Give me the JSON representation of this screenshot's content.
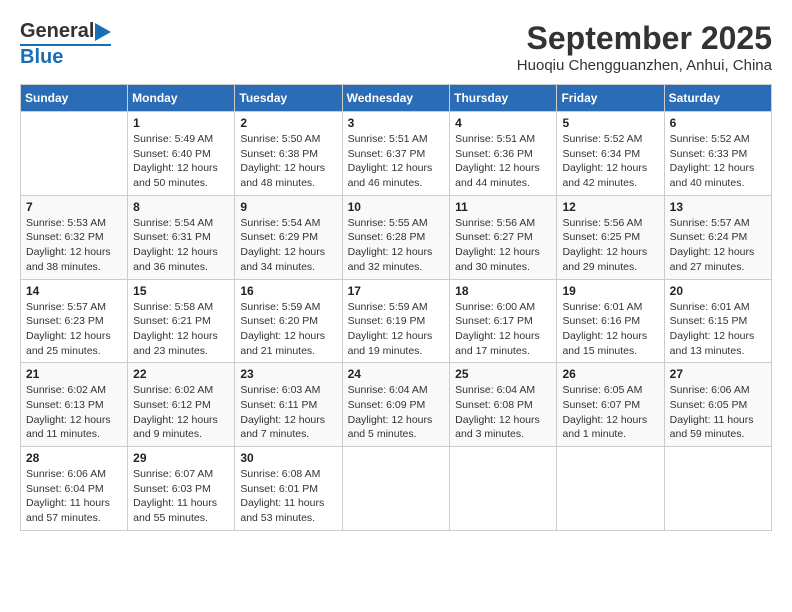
{
  "header": {
    "logo_general": "General",
    "logo_blue": "Blue",
    "title": "September 2025",
    "subtitle": "Huoqiu Chengguanzhen, Anhui, China"
  },
  "days_of_week": [
    "Sunday",
    "Monday",
    "Tuesday",
    "Wednesday",
    "Thursday",
    "Friday",
    "Saturday"
  ],
  "weeks": [
    [
      {
        "num": "",
        "info": ""
      },
      {
        "num": "1",
        "info": "Sunrise: 5:49 AM\nSunset: 6:40 PM\nDaylight: 12 hours\nand 50 minutes."
      },
      {
        "num": "2",
        "info": "Sunrise: 5:50 AM\nSunset: 6:38 PM\nDaylight: 12 hours\nand 48 minutes."
      },
      {
        "num": "3",
        "info": "Sunrise: 5:51 AM\nSunset: 6:37 PM\nDaylight: 12 hours\nand 46 minutes."
      },
      {
        "num": "4",
        "info": "Sunrise: 5:51 AM\nSunset: 6:36 PM\nDaylight: 12 hours\nand 44 minutes."
      },
      {
        "num": "5",
        "info": "Sunrise: 5:52 AM\nSunset: 6:34 PM\nDaylight: 12 hours\nand 42 minutes."
      },
      {
        "num": "6",
        "info": "Sunrise: 5:52 AM\nSunset: 6:33 PM\nDaylight: 12 hours\nand 40 minutes."
      }
    ],
    [
      {
        "num": "7",
        "info": "Sunrise: 5:53 AM\nSunset: 6:32 PM\nDaylight: 12 hours\nand 38 minutes."
      },
      {
        "num": "8",
        "info": "Sunrise: 5:54 AM\nSunset: 6:31 PM\nDaylight: 12 hours\nand 36 minutes."
      },
      {
        "num": "9",
        "info": "Sunrise: 5:54 AM\nSunset: 6:29 PM\nDaylight: 12 hours\nand 34 minutes."
      },
      {
        "num": "10",
        "info": "Sunrise: 5:55 AM\nSunset: 6:28 PM\nDaylight: 12 hours\nand 32 minutes."
      },
      {
        "num": "11",
        "info": "Sunrise: 5:56 AM\nSunset: 6:27 PM\nDaylight: 12 hours\nand 30 minutes."
      },
      {
        "num": "12",
        "info": "Sunrise: 5:56 AM\nSunset: 6:25 PM\nDaylight: 12 hours\nand 29 minutes."
      },
      {
        "num": "13",
        "info": "Sunrise: 5:57 AM\nSunset: 6:24 PM\nDaylight: 12 hours\nand 27 minutes."
      }
    ],
    [
      {
        "num": "14",
        "info": "Sunrise: 5:57 AM\nSunset: 6:23 PM\nDaylight: 12 hours\nand 25 minutes."
      },
      {
        "num": "15",
        "info": "Sunrise: 5:58 AM\nSunset: 6:21 PM\nDaylight: 12 hours\nand 23 minutes."
      },
      {
        "num": "16",
        "info": "Sunrise: 5:59 AM\nSunset: 6:20 PM\nDaylight: 12 hours\nand 21 minutes."
      },
      {
        "num": "17",
        "info": "Sunrise: 5:59 AM\nSunset: 6:19 PM\nDaylight: 12 hours\nand 19 minutes."
      },
      {
        "num": "18",
        "info": "Sunrise: 6:00 AM\nSunset: 6:17 PM\nDaylight: 12 hours\nand 17 minutes."
      },
      {
        "num": "19",
        "info": "Sunrise: 6:01 AM\nSunset: 6:16 PM\nDaylight: 12 hours\nand 15 minutes."
      },
      {
        "num": "20",
        "info": "Sunrise: 6:01 AM\nSunset: 6:15 PM\nDaylight: 12 hours\nand 13 minutes."
      }
    ],
    [
      {
        "num": "21",
        "info": "Sunrise: 6:02 AM\nSunset: 6:13 PM\nDaylight: 12 hours\nand 11 minutes."
      },
      {
        "num": "22",
        "info": "Sunrise: 6:02 AM\nSunset: 6:12 PM\nDaylight: 12 hours\nand 9 minutes."
      },
      {
        "num": "23",
        "info": "Sunrise: 6:03 AM\nSunset: 6:11 PM\nDaylight: 12 hours\nand 7 minutes."
      },
      {
        "num": "24",
        "info": "Sunrise: 6:04 AM\nSunset: 6:09 PM\nDaylight: 12 hours\nand 5 minutes."
      },
      {
        "num": "25",
        "info": "Sunrise: 6:04 AM\nSunset: 6:08 PM\nDaylight: 12 hours\nand 3 minutes."
      },
      {
        "num": "26",
        "info": "Sunrise: 6:05 AM\nSunset: 6:07 PM\nDaylight: 12 hours\nand 1 minute."
      },
      {
        "num": "27",
        "info": "Sunrise: 6:06 AM\nSunset: 6:05 PM\nDaylight: 11 hours\nand 59 minutes."
      }
    ],
    [
      {
        "num": "28",
        "info": "Sunrise: 6:06 AM\nSunset: 6:04 PM\nDaylight: 11 hours\nand 57 minutes."
      },
      {
        "num": "29",
        "info": "Sunrise: 6:07 AM\nSunset: 6:03 PM\nDaylight: 11 hours\nand 55 minutes."
      },
      {
        "num": "30",
        "info": "Sunrise: 6:08 AM\nSunset: 6:01 PM\nDaylight: 11 hours\nand 53 minutes."
      },
      {
        "num": "",
        "info": ""
      },
      {
        "num": "",
        "info": ""
      },
      {
        "num": "",
        "info": ""
      },
      {
        "num": "",
        "info": ""
      }
    ]
  ]
}
